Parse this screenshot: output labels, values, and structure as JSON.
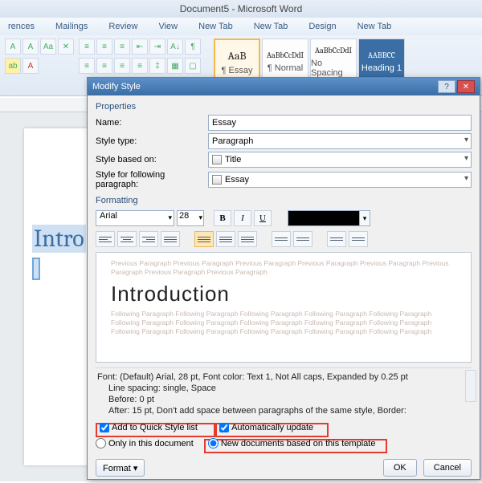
{
  "app": {
    "title": "Document5 - Microsoft Word"
  },
  "tabs": {
    "t0": "rences",
    "t1": "Mailings",
    "t2": "Review",
    "t3": "View",
    "t4": "New Tab",
    "t5": "New Tab",
    "t6": "Design",
    "t7": "New Tab"
  },
  "styles_gallery": {
    "s0": {
      "sample": "AaB",
      "label": "¶ Essay"
    },
    "s1": {
      "sample": "AaBbCcDdI",
      "label": "¶ Normal"
    },
    "s2": {
      "sample": "AaBbCcDdI",
      "label": "No Spacing"
    },
    "s3": {
      "sample": "AABBCC",
      "label": "Heading 1"
    }
  },
  "document": {
    "visible_text": "Intro"
  },
  "dialog": {
    "title": "Modify Style",
    "sections": {
      "properties": "Properties",
      "formatting": "Formatting"
    },
    "labels": {
      "name": "Name:",
      "style_type": "Style type:",
      "based_on": "Style based on:",
      "following": "Style for following paragraph:"
    },
    "values": {
      "name": "Essay",
      "style_type": "Paragraph",
      "based_on": "Title",
      "following": "Essay",
      "font": "Arial",
      "size": "28",
      "color": "#000000"
    },
    "preview": {
      "filler1": "Previous Paragraph Previous Paragraph Previous Paragraph Previous Paragraph Previous Paragraph Previous Paragraph Previous Paragraph Previous Paragraph",
      "title": "Introduction",
      "filler2": "Following Paragraph Following Paragraph Following Paragraph Following Paragraph Following Paragraph Following Paragraph Following Paragraph Following Paragraph Following Paragraph Following Paragraph Following Paragraph Following Paragraph Following Paragraph Following Paragraph Following Paragraph"
    },
    "description": {
      "line1": "Font: (Default) Arial, 28 pt, Font color: Text 1, Not All caps, Expanded by  0.25 pt",
      "line2": "Line spacing:  single, Space",
      "line3": "Before:  0 pt",
      "line4": "After:   15 pt, Don't add space between paragraphs of the same style, Border:"
    },
    "checkboxes": {
      "quick_style": {
        "label": "Add to Quick Style list",
        "checked": true
      },
      "auto_update": {
        "label": "Automatically update",
        "checked": true
      }
    },
    "radios": {
      "only_doc": {
        "label": "Only in this document",
        "checked": false
      },
      "new_templ": {
        "label": "New documents based on this template",
        "checked": true
      }
    },
    "buttons": {
      "format": "Format ▾",
      "ok": "OK",
      "cancel": "Cancel"
    }
  }
}
